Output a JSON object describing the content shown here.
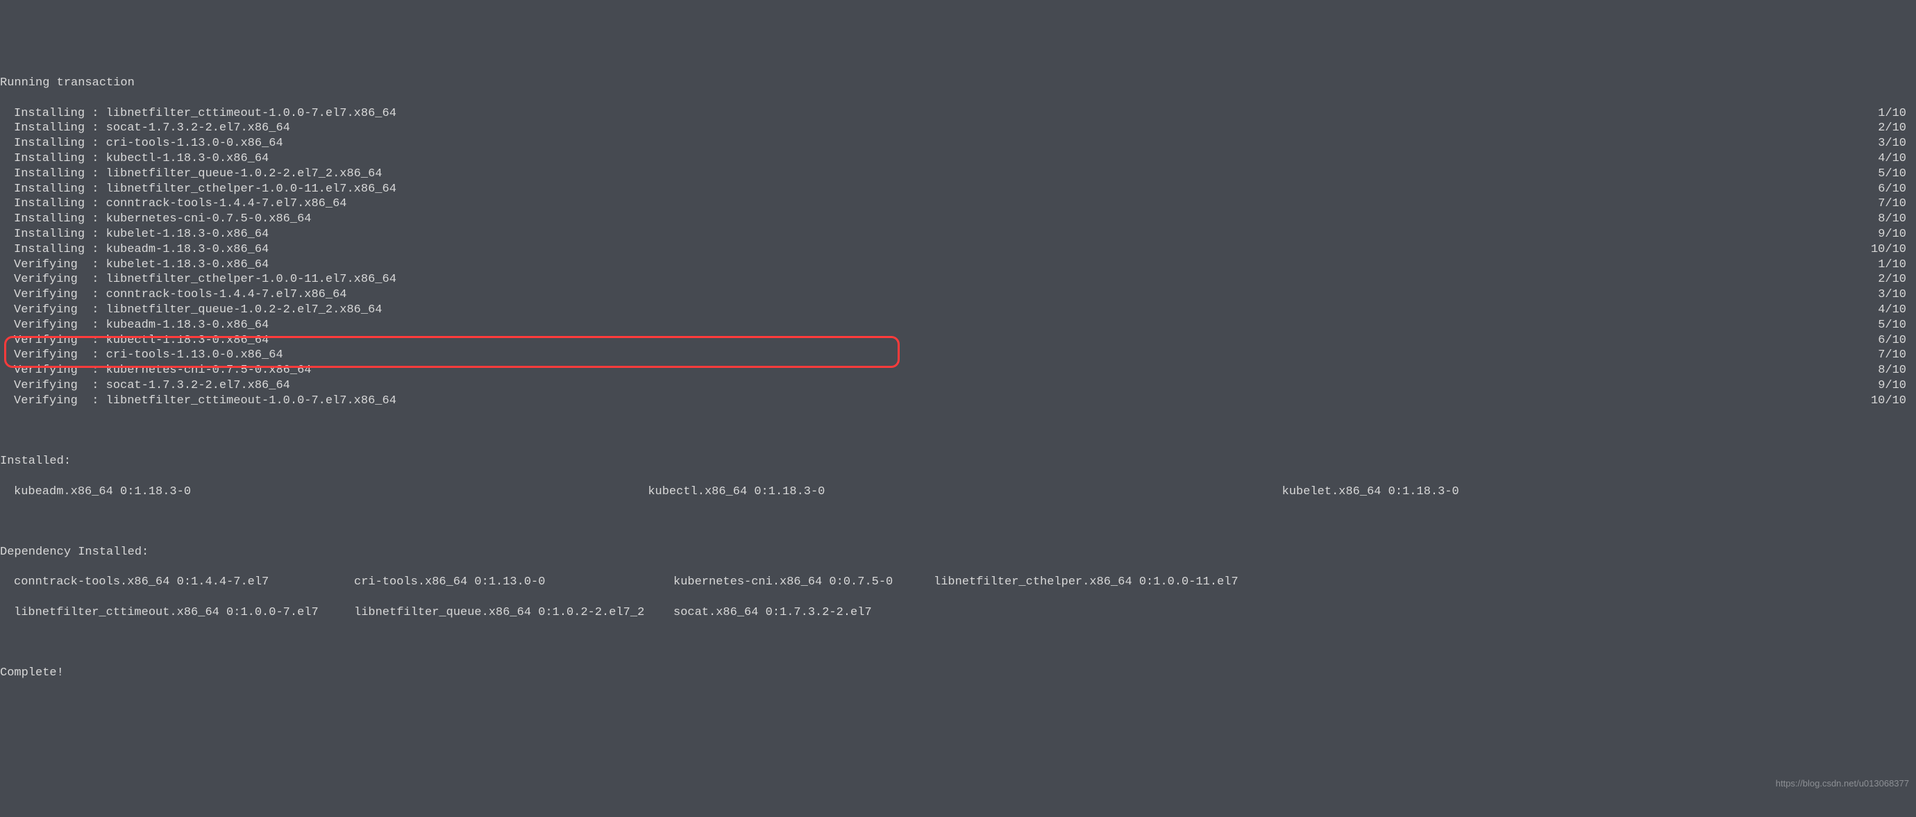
{
  "header": "Running transaction",
  "total": 10,
  "steps": [
    {
      "action": "Installing",
      "package": "libnetfilter_cttimeout-1.0.0-7.el7.x86_64",
      "n": 1
    },
    {
      "action": "Installing",
      "package": "socat-1.7.3.2-2.el7.x86_64",
      "n": 2
    },
    {
      "action": "Installing",
      "package": "cri-tools-1.13.0-0.x86_64",
      "n": 3
    },
    {
      "action": "Installing",
      "package": "kubectl-1.18.3-0.x86_64",
      "n": 4
    },
    {
      "action": "Installing",
      "package": "libnetfilter_queue-1.0.2-2.el7_2.x86_64",
      "n": 5
    },
    {
      "action": "Installing",
      "package": "libnetfilter_cthelper-1.0.0-11.el7.x86_64",
      "n": 6
    },
    {
      "action": "Installing",
      "package": "conntrack-tools-1.4.4-7.el7.x86_64",
      "n": 7
    },
    {
      "action": "Installing",
      "package": "kubernetes-cni-0.7.5-0.x86_64",
      "n": 8
    },
    {
      "action": "Installing",
      "package": "kubelet-1.18.3-0.x86_64",
      "n": 9
    },
    {
      "action": "Installing",
      "package": "kubeadm-1.18.3-0.x86_64",
      "n": 10
    },
    {
      "action": "Verifying",
      "package": "kubelet-1.18.3-0.x86_64",
      "n": 1
    },
    {
      "action": "Verifying",
      "package": "libnetfilter_cthelper-1.0.0-11.el7.x86_64",
      "n": 2
    },
    {
      "action": "Verifying",
      "package": "conntrack-tools-1.4.4-7.el7.x86_64",
      "n": 3
    },
    {
      "action": "Verifying",
      "package": "libnetfilter_queue-1.0.2-2.el7_2.x86_64",
      "n": 4
    },
    {
      "action": "Verifying",
      "package": "kubeadm-1.18.3-0.x86_64",
      "n": 5
    },
    {
      "action": "Verifying",
      "package": "kubectl-1.18.3-0.x86_64",
      "n": 6
    },
    {
      "action": "Verifying",
      "package": "cri-tools-1.13.0-0.x86_64",
      "n": 7
    },
    {
      "action": "Verifying",
      "package": "kubernetes-cni-0.7.5-0.x86_64",
      "n": 8
    },
    {
      "action": "Verifying",
      "package": "socat-1.7.3.2-2.el7.x86_64",
      "n": 9
    },
    {
      "action": "Verifying",
      "package": "libnetfilter_cttimeout-1.0.0-7.el7.x86_64",
      "n": 10
    }
  ],
  "installed_label": "Installed:",
  "installed": [
    "kubeadm.x86_64 0:1.18.3-0",
    "kubectl.x86_64 0:1.18.3-0",
    "kubelet.x86_64 0:1.18.3-0"
  ],
  "dep_label": "Dependency Installed:",
  "dep_row1": [
    "conntrack-tools.x86_64 0:1.4.4-7.el7",
    "cri-tools.x86_64 0:1.13.0-0",
    "kubernetes-cni.x86_64 0:0.7.5-0",
    "libnetfilter_cthelper.x86_64 0:1.0.0-11.el7"
  ],
  "dep_row2": [
    "libnetfilter_cttimeout.x86_64 0:1.0.0-7.el7",
    "libnetfilter_queue.x86_64 0:1.0.2-2.el7_2",
    "socat.x86_64 0:1.7.3.2-2.el7"
  ],
  "complete": "Complete!",
  "watermark": "https://blog.csdn.net/u013068377"
}
